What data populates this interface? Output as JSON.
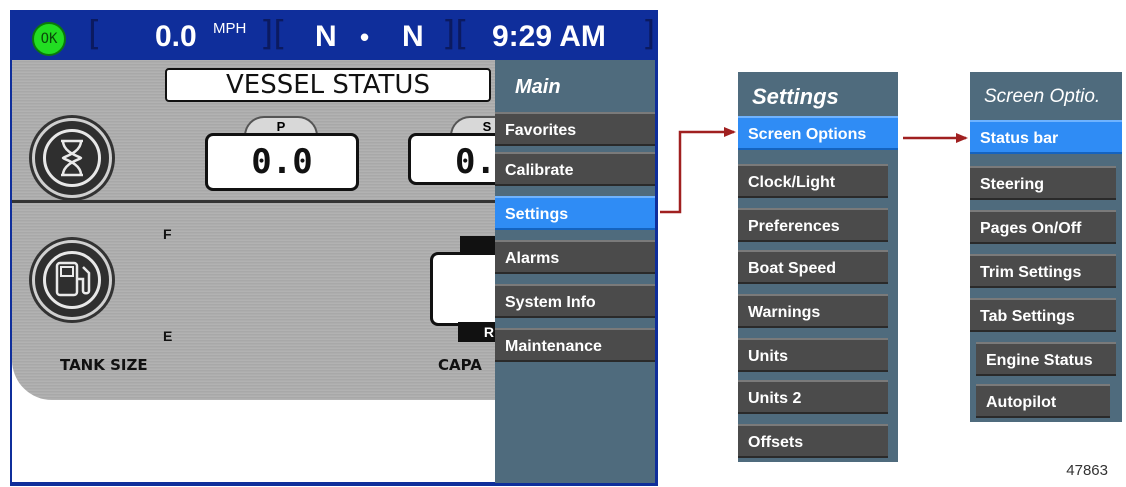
{
  "status_bar": {
    "ok_label": "OK",
    "speed_value": "0.0",
    "speed_unit": "MPH",
    "gear_left": "N",
    "gear_sep": "•",
    "gear_right": "N",
    "time": "9:29 AM"
  },
  "panel": {
    "title": "VESSEL STATUS",
    "port_tab": "P",
    "starboard_tab": "S",
    "port_value": "0.0",
    "starboard_value": "0.",
    "fuel_full": "F",
    "fuel_empty": "E",
    "tank_label": "TANK SIZE",
    "capacity_label": "CAPA",
    "reverse_label": "R"
  },
  "main_menu": {
    "title": "Main",
    "items": [
      "Favorites",
      "Calibrate",
      "Settings",
      "Alarms",
      "System Info",
      "Maintenance"
    ],
    "selected": "Settings"
  },
  "settings_menu": {
    "title": "Settings",
    "items": [
      "Screen Options",
      "Clock/Light",
      "Preferences",
      "Boat Speed",
      "Warnings",
      "Units",
      "Units 2",
      "Offsets"
    ],
    "selected": "Screen Options"
  },
  "screen_menu": {
    "title": "Screen Optio.",
    "items": [
      "Status bar",
      "Steering",
      "Pages On/Off",
      "Trim Settings",
      "Tab Settings",
      "Engine Status",
      "Autopilot"
    ],
    "selected": "Status bar"
  },
  "figure_number": "47863",
  "colors": {
    "frame_blue": "#0f2e9b",
    "menu_slate": "#4f6b7d",
    "item_gray": "#4b4b4b",
    "selected_blue": "#2f8cf5",
    "arrow_red": "#a02020",
    "ok_green": "#22dd22"
  }
}
